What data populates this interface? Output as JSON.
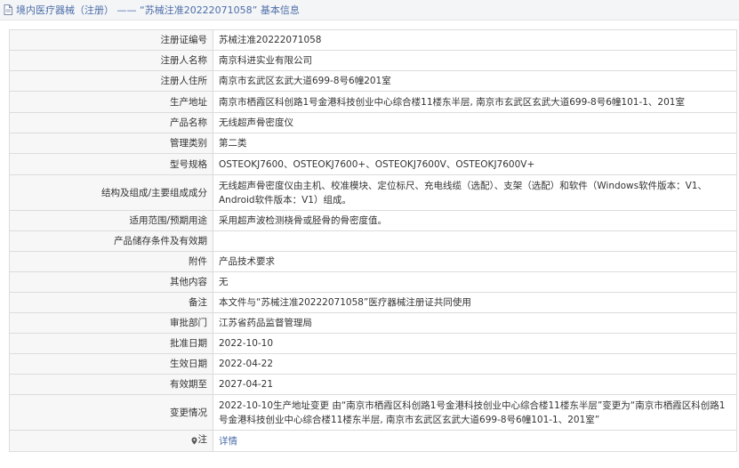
{
  "header": {
    "title": "境内医疗器械（注册） —— “苏械注准20222071058” 基本信息",
    "icon": "document-icon"
  },
  "rows": [
    {
      "label": "注册证编号",
      "value": "苏械注准20222071058"
    },
    {
      "label": "注册人名称",
      "value": "南京科进实业有限公司"
    },
    {
      "label": "注册人住所",
      "value": "南京市玄武区玄武大道699-8号6幢201室"
    },
    {
      "label": "生产地址",
      "value": "南京市栖霞区科创路1号金港科技创业中心综合楼11楼东半层, 南京市玄武区玄武大道699-8号6幢101-1、201室"
    },
    {
      "label": "产品名称",
      "value": "无线超声骨密度仪"
    },
    {
      "label": "管理类别",
      "value": "第二类"
    },
    {
      "label": "型号规格",
      "value": "OSTEOKJ7600、OSTEOKJ7600+、OSTEOKJ7600V、OSTEOKJ7600V+"
    },
    {
      "label": "结构及组成/主要组成成分",
      "value": "无线超声骨密度仪由主机、校准模块、定位标尺、充电线缆（选配）、支架（选配）和软件（Windows软件版本：V1、Android软件版本：V1）组成。"
    },
    {
      "label": "适用范围/预期用途",
      "value": "采用超声波检测桡骨或胫骨的骨密度值。"
    },
    {
      "label": "产品储存条件及有效期",
      "value": ""
    },
    {
      "label": "附件",
      "value": "产品技术要求"
    },
    {
      "label": "其他内容",
      "value": "无"
    },
    {
      "label": "备注",
      "value": "本文件与“苏械注准20222071058”医疗器械注册证共同使用"
    },
    {
      "label": "审批部门",
      "value": "江苏省药品监督管理局"
    },
    {
      "label": "批准日期",
      "value": "2022-10-10"
    },
    {
      "label": "生效日期",
      "value": "2022-04-22"
    },
    {
      "label": "有效期至",
      "value": "2027-04-21"
    },
    {
      "label": "变更情况",
      "value": "2022-10-10生产地址变更 由“南京市栖霞区科创路1号金港科技创业中心综合楼11楼东半层”变更为“南京市栖霞区科创路1号金港科技创业中心综合楼11楼东半层, 南京市玄武区玄武大道699-8号6幢101-1、201室”"
    }
  ],
  "detail_row": {
    "label": "注",
    "link": "详情",
    "icon": "location-pin-icon"
  },
  "colors": {
    "title_text": "#4c6ea8",
    "title_bar_bg": "#f4f5f7",
    "label_bg": "#f7f7f7",
    "border": "#dcdcdc",
    "link": "#4c6ea8"
  }
}
